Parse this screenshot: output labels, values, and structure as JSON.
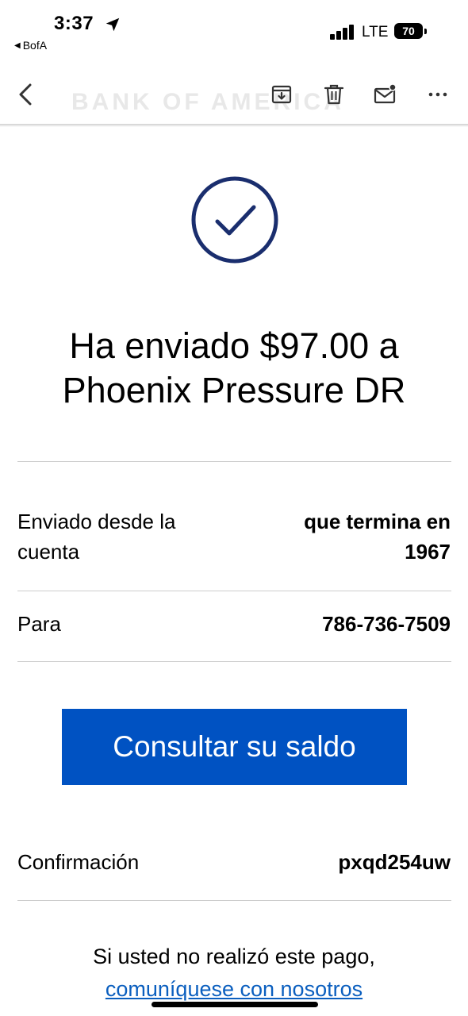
{
  "status_bar": {
    "time": "3:37",
    "back_app": "BofA",
    "network": "LTE",
    "battery": "70"
  },
  "toolbar": {
    "watermark": "BANK OF AMERICA",
    "icons": [
      "chevron-left-icon",
      "archive-icon",
      "trash-icon",
      "mail-unread-icon",
      "more-icon"
    ]
  },
  "message": {
    "headline": "Ha enviado $97.00 a Phoenix Pressure DR",
    "rows": [
      {
        "label": "Enviado desde la cuenta",
        "value": "que termina en 1967"
      },
      {
        "label": "Para",
        "value": "786-736-7509"
      }
    ],
    "cta_label": "Consultar su saldo",
    "confirmation": {
      "label": "Confirmación",
      "value": "pxqd254uw"
    },
    "footer_text": "Si usted no realizó este pago,",
    "footer_link": "comuníquese con nosotros"
  },
  "colors": {
    "accent": "#0052c2",
    "check": "#1a2e6e",
    "link": "#0b5fbf"
  }
}
